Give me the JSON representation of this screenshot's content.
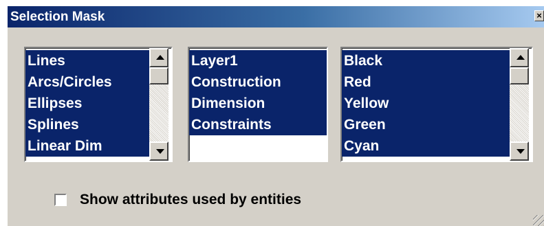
{
  "window": {
    "title": "Selection Mask",
    "close_label": "×"
  },
  "entity_types": {
    "items": [
      "Lines",
      "Arcs/Circles",
      "Ellipses",
      "Splines",
      "Linear Dim"
    ]
  },
  "layers": {
    "items": [
      "Layer1",
      "Construction",
      "Dimension",
      "Constraints"
    ]
  },
  "colors": {
    "items": [
      "Black",
      "Red",
      "Yellow",
      "Green",
      "Cyan"
    ]
  },
  "options": {
    "show_attributes_label": "Show attributes used by entities",
    "show_attributes_checked": false
  },
  "theme": {
    "selection": "#0a246a",
    "face": "#d4d0c8",
    "title_start": "#0a246a",
    "title_end": "#a6caf0"
  }
}
